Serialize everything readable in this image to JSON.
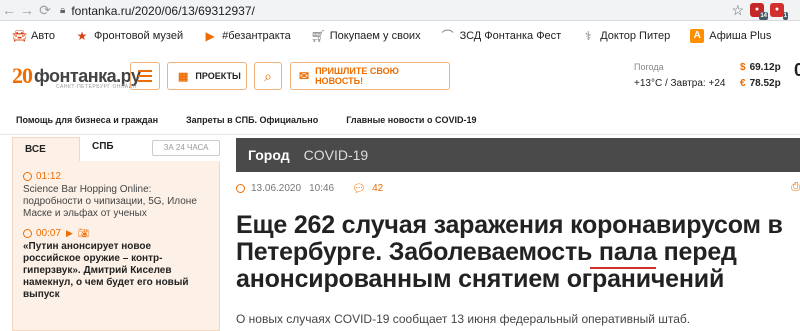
{
  "browser": {
    "url": "fontanka.ru/2020/06/13/69312937/",
    "ext1_badge": "14",
    "ext2_badge": "1"
  },
  "topnav": {
    "items": [
      {
        "label": "Авто",
        "icon": "car-icon"
      },
      {
        "label": "Фронтовой музей",
        "icon": "star-icon"
      },
      {
        "label": "#безантракта",
        "icon": "play-icon"
      },
      {
        "label": "Покупаем у своих",
        "icon": "basket-icon"
      },
      {
        "label": "ЗСД Фонтанка Фест",
        "icon": "bridge-icon"
      },
      {
        "label": "Доктор Питер",
        "icon": "doctor-icon"
      },
      {
        "label": "Афиша Plus",
        "icon": "afisha-icon"
      }
    ]
  },
  "header": {
    "logo_number": "20",
    "logo_name": "фонтанка.ру",
    "logo_subtitle": "САНКТ-ПЕТЕРБУРГ ОНЛАЙН",
    "projects_label": "ПРОЕКТЫ",
    "send_news_label": "ПРИШЛИТЕ СВОЮ НОВОСТЬ!",
    "weather_label": "Погода",
    "weather_values": "+13°C / Завтра: +24",
    "rates": [
      {
        "symbol": "$",
        "value": "69.12р"
      },
      {
        "symbol": "€",
        "value": "78.52р"
      }
    ],
    "edge_digit": "0"
  },
  "seclinks": [
    "Помощь для бизнеса и граждан",
    "Запреты в СПБ. Официально",
    "Главные новости о COVID-19"
  ],
  "sidebar": {
    "tab_all": "ВСЕ",
    "tab_spb": "СПБ",
    "tab_24": "ЗА 24 ЧАСА",
    "items": [
      {
        "time": "01:12",
        "text": "Science Bar Hopping Online: подробности о чипизации, 5G, Илоне Маске и эльфах от ученых",
        "bold": false
      },
      {
        "time": "00:07",
        "text": "«Путин анонсирует новое российское оружие – контр-гиперзвук». Дмитрий Киселев намекнул, о чем будет его новый выпуск",
        "bold": true
      }
    ]
  },
  "article": {
    "section": "Город",
    "tag": "COVID-19",
    "date": "13.06.2020",
    "time": "10:46",
    "comments": "42",
    "title": "Еще 262 случая заражения коронавирусом в Петербурге. Заболеваемость пала перед анонсированным снятием ограничений",
    "lead": "О новых случаях COVID-19 сообщает 13 июня федеральный оперативный штаб."
  },
  "colors": {
    "accent": "#ef6c00",
    "section_bar": "#4a4a4a",
    "sidebar_bg": "#fdf1e7"
  }
}
